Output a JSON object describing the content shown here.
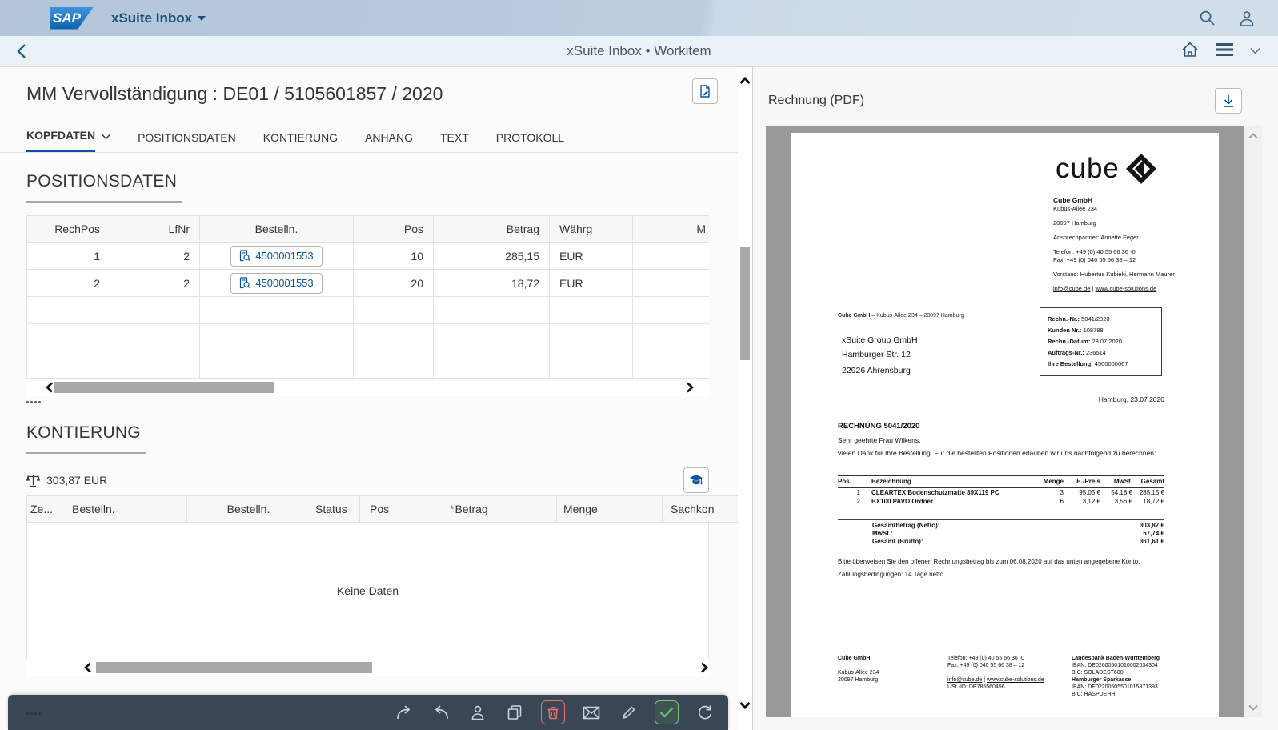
{
  "colors": {
    "accent": "#0854a0",
    "shell_title": "#17507c",
    "toolbar_bg": "#3a4653",
    "delete_red": "#e5726f",
    "approve_green": "#7fbf7f"
  },
  "shell": {
    "logo_text": "SAP",
    "app_title": "xSuite Inbox"
  },
  "nav": {
    "breadcrumb": "xSuite Inbox • Workitem"
  },
  "workitem": {
    "title": "MM Vervollständigung : DE01 / 5105601857 / 2020",
    "tabs": [
      {
        "label": "KOPFDATEN",
        "selected": true
      },
      {
        "label": "POSITIONSDATEN",
        "selected": false
      },
      {
        "label": "KONTIERUNG",
        "selected": false
      },
      {
        "label": "ANHANG",
        "selected": false
      },
      {
        "label": "TEXT",
        "selected": false
      },
      {
        "label": "PROTOKOLL",
        "selected": false
      }
    ]
  },
  "pos": {
    "heading": "POSITIONSDATEN",
    "columns": [
      "RechPos",
      "LfNr",
      "Bestelln.",
      "Pos",
      "Betrag",
      "Währg",
      "M"
    ],
    "rows": [
      {
        "rechpos": "1",
        "lfnr": "2",
        "bestelln": "4500001553",
        "pos": "10",
        "betrag": "285,15",
        "waehrg": "EUR"
      },
      {
        "rechpos": "2",
        "lfnr": "2",
        "bestelln": "4500001553",
        "pos": "20",
        "betrag": "18,72",
        "waehrg": "EUR"
      }
    ]
  },
  "kont": {
    "heading": "KONTIERUNG",
    "balance": "303,87 EUR",
    "required_marker": "*",
    "columns": [
      "Ze...",
      "Bestelln.",
      "Bestelln.",
      "Status",
      "Pos",
      "Betrag",
      "Menge",
      "Sachkon"
    ],
    "no_data": "Keine Daten"
  },
  "footer_toolbar": {
    "icons": [
      "share",
      "undo",
      "claim-user",
      "copy",
      "delete",
      "email",
      "edit",
      "approve",
      "refresh"
    ]
  },
  "pdf": {
    "title": "Rechnung (PDF)",
    "logo_text": "cube",
    "separator": "|",
    "supplier": {
      "name": "Cube GmbH",
      "street": "Kubus-Allee 234",
      "city": "20097 Hamburg",
      "contact": "Ansprechpartner: Annette Feger",
      "phone": "Telefon: +49 (0) 40 55 66 36 -0",
      "fax": "Fax: +49 (0) 040 55 66 38 – 12",
      "board": "Vorstand: Hubertus Kubieki, Hermann Maurer",
      "email": "info@cube.de",
      "web": "www.cube-solutions.de"
    },
    "sender_line_bold": "Cube GmbH",
    "sender_line_rest": " – Kubus-Allee 234 – 20097 Hamburg",
    "recipient": {
      "name": "xSuite Group GmbH",
      "street": "Hamburger Str. 12",
      "city": "22926 Ahrensburg"
    },
    "meta": [
      {
        "label": "Rechn.-Nr.:",
        "value": "5041/2020"
      },
      {
        "label": "Kunden Nr.:",
        "value": "108788"
      },
      {
        "label": "Rechn.-Datum:",
        "value": "23.07.2020"
      },
      {
        "label": "Auftrags-Nr.:",
        "value": "236514"
      },
      {
        "label": "Ihre Bestellung:",
        "value": "4500000067"
      }
    ],
    "place_date": "Hamburg, 23.07.2020",
    "heading": "RECHNUNG 5041/2020",
    "salutation": "Sehr geehrte Frau Wilkens,",
    "intro": "vielen Dank für Ihre Bestellung. Für die bestellten Positionen erlauben wir uns nachfolgend zu berechnen:",
    "items_columns": [
      "Pos.",
      "Bezeichnung",
      "Menge",
      "E.-Preis",
      "MwSt.",
      "Gesamt"
    ],
    "items": [
      {
        "pos": "1",
        "name": "CLEARTEX Bodenschutzmatte 89X119 PC",
        "menge": "3",
        "preis": "95,05 €",
        "mwst": "54,18 €",
        "gesamt": "285,15 €"
      },
      {
        "pos": "2",
        "name": "BX100 PAVO Ordner",
        "menge": "6",
        "preis": "3,12 €",
        "mwst": "3,56 €",
        "gesamt": "18,72 €"
      }
    ],
    "totals": [
      {
        "label": "Gesamtbetrag (Netto):",
        "value": "303,87 €"
      },
      {
        "label": "MwSt.:",
        "value": "57,74 €"
      },
      {
        "label": "Gesamt (Brutto):",
        "value": "361,61 €"
      }
    ],
    "payment_note": "Bitte überweisen Sie den offenen Rechnungsbetrag bis zum 06.08.2020 auf das unten angegebene Konto.",
    "terms": "Zahlungsbedingungen: 14 Tage netto",
    "footer": {
      "col1": [
        "Cube GmbH",
        "Kubus-Allee 234",
        "20097 Hamburg"
      ],
      "col2": [
        "Telefon: +49 (0) 40 55 66 36 -0",
        "Fax: +49 (0) 040 55 66 38 – 12"
      ],
      "email": "info@cube.de",
      "web": "www.cube-solutions.de",
      "ustid": "USt.-ID: DE785560456",
      "bank": [
        "Landesbank Baden-Württemberg",
        "IBAN: DE02600501010002034304",
        "BIC: SOLADEST600",
        "Hamburger Sparkasse",
        "IBAN: DE02200505501015871393",
        "BIC: HASPDEHH"
      ]
    }
  }
}
